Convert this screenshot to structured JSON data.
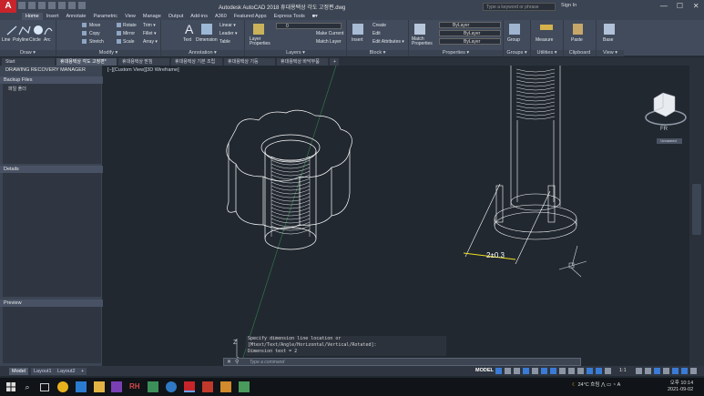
{
  "window": {
    "app_logo": "A",
    "title": "Autodesk AutoCAD 2018    휴대용택상 각도 고정편.dwg",
    "search_placeholder": "Type a keyword or phrase",
    "sign_in": "Sign In",
    "controls": [
      "—",
      "☐",
      "✕"
    ]
  },
  "ribbon_tabs": [
    "Home",
    "Insert",
    "Annotate",
    "Parametric",
    "View",
    "Manage",
    "Output",
    "Add-ins",
    "A360",
    "Featured Apps",
    "Express Tools",
    "■▾"
  ],
  "ribbon": {
    "draw": {
      "label": "Draw ▾",
      "tools": [
        "Line",
        "Polyline",
        "Circle",
        "Arc"
      ]
    },
    "modify": {
      "label": "Modify ▾",
      "tools": [
        "Move",
        "Rotate",
        "Trim ▾",
        "Copy",
        "Mirror",
        "Fillet ▾",
        "Stretch",
        "Scale",
        "Array ▾"
      ]
    },
    "annotation": {
      "label": "Annotation ▾",
      "tools": [
        "Text",
        "Dimension",
        "Linear ▾",
        "Leader ▾",
        "Table"
      ]
    },
    "layers": {
      "label": "Layers ▾",
      "tools": [
        "Layer Properties",
        "Make Current",
        "Match Layer"
      ],
      "current_layer": "0"
    },
    "block": {
      "label": "Block ▾",
      "tools": [
        "Insert",
        "Create",
        "Edit",
        "Edit Attributes ▾"
      ]
    },
    "properties": {
      "label": "Properties ▾",
      "tools": [
        "Match Properties"
      ],
      "color": "ByLayer",
      "linetype": "ByLayer",
      "lineweight": "ByLayer"
    },
    "groups": {
      "label": "Groups ▾",
      "tools": [
        "Group"
      ]
    },
    "utilities": {
      "label": "Utilities ▾",
      "tools": [
        "Measure"
      ]
    },
    "clipboard": {
      "label": "Clipboard",
      "tools": [
        "Paste"
      ]
    },
    "view": {
      "label": "View ▾",
      "tools": [
        "Base"
      ]
    }
  },
  "doc_tabs": [
    "Start",
    "휴대용택상 각도 고정편*",
    "휴대용택상 받침",
    "휴대용택상 기본 조립",
    "휴대용택상 기둥",
    "휴대용택상 바닥부품",
    "+"
  ],
  "recovery_panel": {
    "title": "DRAWING RECOVERY MANAGER",
    "backup_header": "Backup Files",
    "backup_item": "파일 폴더",
    "details_header": "Details",
    "preview_header": "Preview"
  },
  "viewport": {
    "label": "[−][Custom View][3D Wireframe]",
    "dimension_text": "2±0.3",
    "viewcube_label": "Unnamed",
    "wcs": "▾"
  },
  "command": {
    "history": [
      "Specify dimension line location or",
      "[Mtext/Text/Angle/Horizontal/Vertical/Rotated]:",
      "Dimension text = 2"
    ],
    "prompt": "Type a command"
  },
  "layout_tabs": [
    "Model",
    "Layout1",
    "Layout2",
    "+"
  ],
  "status": {
    "model": "MODEL",
    "scale": "1:1"
  },
  "taskbar": {
    "weather": "24°C 흐림",
    "lang": "A",
    "time": "오후 10:14",
    "date": "2021-09-02"
  },
  "colors": {
    "accent": "#c8242b",
    "cad_bg": "#212830",
    "wire": "#ffffff",
    "dim": "#f0e020"
  }
}
